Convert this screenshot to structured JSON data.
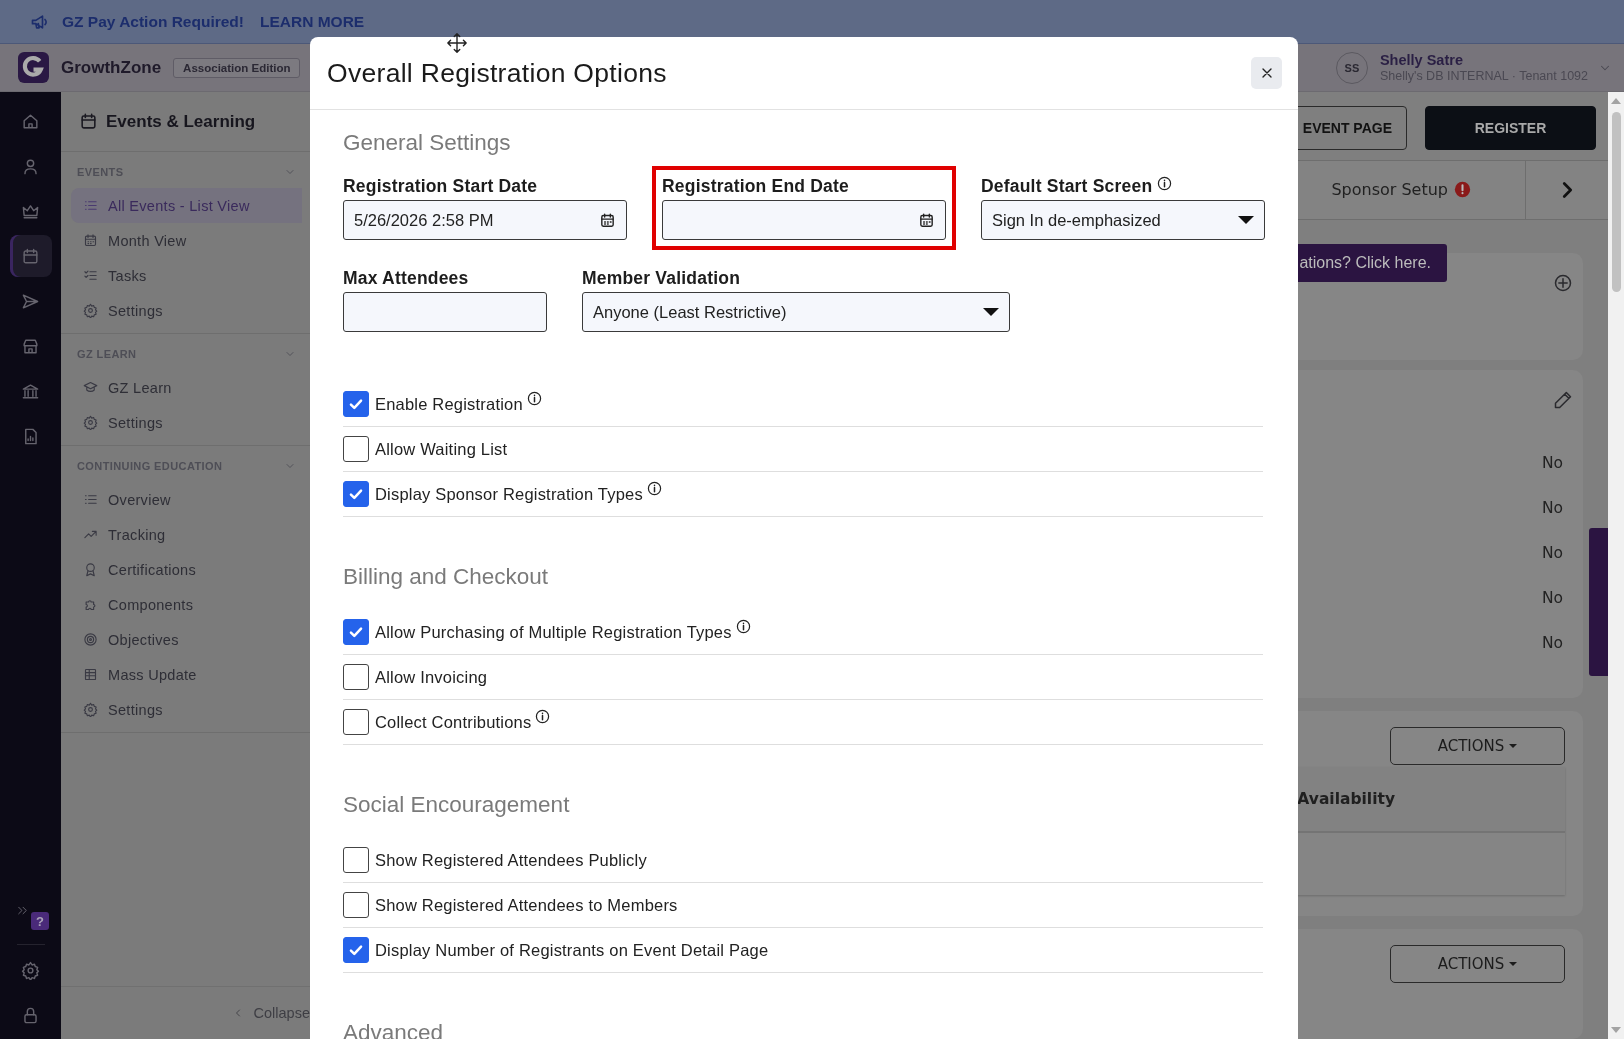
{
  "banner": {
    "message": "GZ Pay Action Required!",
    "link": "LEARN MORE"
  },
  "header": {
    "app_name": "GrowthZone",
    "edition": "Association Edition",
    "user": {
      "initials": "SS",
      "name": "Shelly Satre",
      "subtitle": "Shelly's DB INTERNAL · Tenant 1092"
    }
  },
  "rail": {
    "items": [
      {
        "selected": false
      },
      {
        "selected": false
      },
      {
        "selected": false
      },
      {
        "selected": true
      },
      {
        "selected": false
      },
      {
        "selected": false
      },
      {
        "selected": false
      },
      {
        "selected": false
      }
    ],
    "help_badge": "?"
  },
  "sidebar": {
    "title": "Events & Learning",
    "sections": [
      {
        "heading": "EVENTS",
        "items": [
          {
            "label": "All Events - List View",
            "selected": true
          },
          {
            "label": "Month View",
            "selected": false
          },
          {
            "label": "Tasks",
            "selected": false
          },
          {
            "label": "Settings",
            "selected": false
          }
        ]
      },
      {
        "heading": "GZ LEARN",
        "items": [
          {
            "label": "GZ Learn",
            "selected": false
          },
          {
            "label": "Settings",
            "selected": false
          }
        ]
      },
      {
        "heading": "CONTINUING EDUCATION",
        "items": [
          {
            "label": "Overview",
            "selected": false
          },
          {
            "label": "Tracking",
            "selected": false
          },
          {
            "label": "Certifications",
            "selected": false
          },
          {
            "label": "Components",
            "selected": false
          },
          {
            "label": "Objectives",
            "selected": false
          },
          {
            "label": "Mass Update",
            "selected": false
          },
          {
            "label": "Settings",
            "selected": false
          }
        ]
      }
    ],
    "collapse": "Collapse"
  },
  "page": {
    "buttons": [
      {
        "label": "EVENT PAGE",
        "kind": "outline"
      },
      {
        "label": "REGISTER",
        "kind": "solid"
      }
    ],
    "tab": {
      "label": "Sponsor Setup",
      "alert": true
    },
    "promo": "ations? Click here.",
    "values": [
      "No",
      "No",
      "No",
      "No",
      "No"
    ],
    "actions": [
      "ACTIONS",
      "ACTIONS"
    ],
    "table_header": "Availability"
  },
  "modal": {
    "title": "Overall Registration Options",
    "sections": [
      {
        "heading": "General Settings",
        "field_rows": [
          [
            {
              "label": "Registration Start Date",
              "kind": "date",
              "value": "5/26/2026 2:58 PM",
              "highlighted": false,
              "info": false
            },
            {
              "label": "Registration End Date",
              "kind": "date",
              "highlighted": true,
              "info": false
            },
            {
              "label": "Default Start Screen",
              "kind": "select",
              "value": "Sign In de-emphasized",
              "highlighted": false,
              "info": true
            }
          ],
          [
            {
              "label": "Max Attendees",
              "kind": "text",
              "highlighted": false,
              "info": false
            },
            {
              "label": "Member Validation",
              "kind": "select",
              "value": "Anyone (Least Restrictive)",
              "highlighted": false,
              "info": false
            }
          ]
        ],
        "options": [
          {
            "label": "Enable Registration",
            "checked": true,
            "info": true
          },
          {
            "label": "Allow Waiting List",
            "checked": false,
            "info": false
          },
          {
            "label": "Display Sponsor Registration Types",
            "checked": true,
            "info": true
          }
        ]
      },
      {
        "heading": "Billing and Checkout",
        "options": [
          {
            "label": "Allow Purchasing of Multiple Registration Types",
            "checked": true,
            "info": true
          },
          {
            "label": "Allow Invoicing",
            "checked": false,
            "info": false
          },
          {
            "label": "Collect Contributions",
            "checked": false,
            "info": true
          }
        ]
      },
      {
        "heading": "Social Encouragement",
        "options": [
          {
            "label": "Show Registered Attendees Publicly",
            "checked": false,
            "info": false
          },
          {
            "label": "Show Registered Attendees to Members",
            "checked": false,
            "info": false
          },
          {
            "label": "Display Number of Registrants on Event Detail Page",
            "checked": true,
            "info": false
          }
        ]
      },
      {
        "heading": "Advanced"
      }
    ]
  }
}
